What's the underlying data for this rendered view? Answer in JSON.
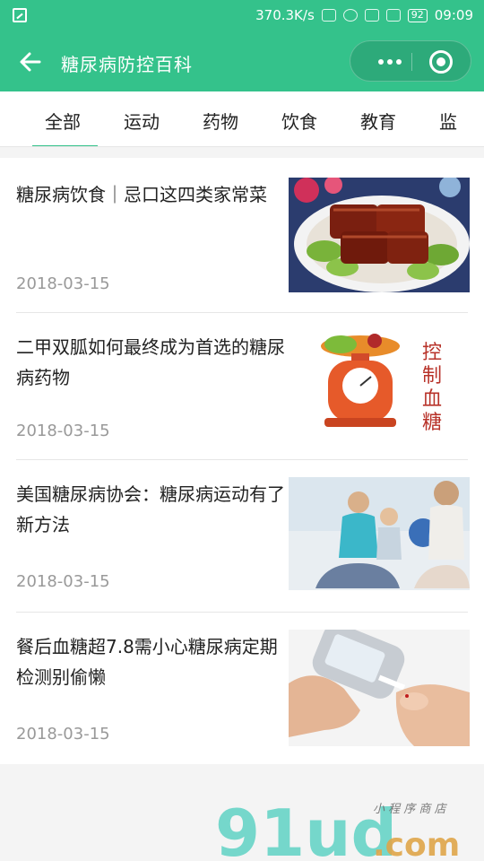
{
  "status_bar": {
    "net_speed": "370.3K/s",
    "battery": "92",
    "time": "09:09"
  },
  "header": {
    "title": "糖尿病防控百科"
  },
  "tabs": [
    "全部",
    "运动",
    "药物",
    "饮食",
    "教育",
    "监"
  ],
  "articles": [
    {
      "title": "糖尿病饮食｜忌口这四类家常菜",
      "date": "2018-03-15",
      "image": "braised-pork-dish"
    },
    {
      "title": "二甲双胍如何最终成为首选的糖尿病药物",
      "date": "2018-03-15",
      "image": "scale-with-vegetables",
      "image_text": "控制血糖"
    },
    {
      "title": "美国糖尿病协会：糖尿病运动有了新方法",
      "date": "2018-03-15",
      "image": "women-doing-yoga"
    },
    {
      "title": "餐后血糖超7.8需小心糖尿病定期检测别偷懒",
      "date": "2018-03-15",
      "image": "glucose-meter-finger-test"
    }
  ],
  "watermark": {
    "logo": "91ud",
    "domain": ".com",
    "tagline": "小程序商店"
  },
  "colors": {
    "brand": "#34c28b",
    "date": "#999999"
  }
}
